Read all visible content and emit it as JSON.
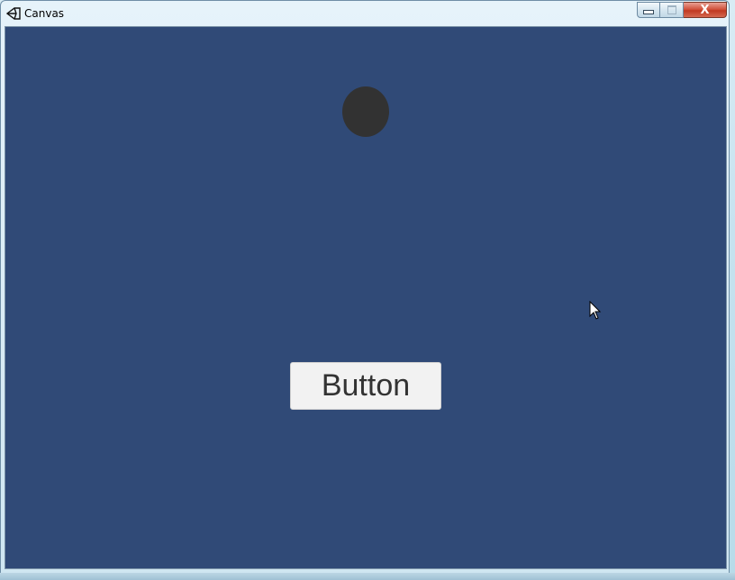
{
  "window": {
    "title": "Canvas",
    "controls": {
      "minimize_icon": "minimize-icon",
      "maximize_icon": "maximize-icon",
      "close_label": "X"
    }
  },
  "canvas": {
    "background_color": "#304a77",
    "ball_color": "#323232",
    "button": {
      "label": "Button",
      "background_color": "#f2f2f2",
      "text_color": "#333333"
    }
  }
}
